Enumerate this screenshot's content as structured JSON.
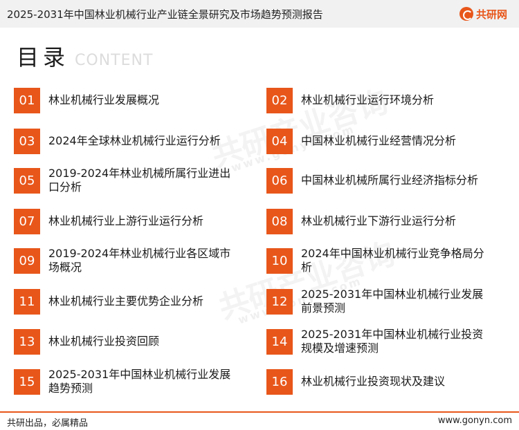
{
  "header": {
    "title": "2025-2031年中国林业机械行业产业链全景研究及市场趋势预测报告",
    "logo_text": "共研网"
  },
  "toc": {
    "title": "目录",
    "subtitle": "CONTENT",
    "items": [
      {
        "num": "01",
        "label": "林业机械行业发展概况"
      },
      {
        "num": "02",
        "label": "林业机械行业运行环境分析"
      },
      {
        "num": "03",
        "label": "2024年全球林业机械行业运行分析"
      },
      {
        "num": "04",
        "label": "中国林业机械行业经营情况分析"
      },
      {
        "num": "05",
        "label": "2019-2024年林业机械所属行业进出口分析"
      },
      {
        "num": "06",
        "label": "中国林业机械所属行业经济指标分析"
      },
      {
        "num": "07",
        "label": "林业机械行业上游行业运行分析"
      },
      {
        "num": "08",
        "label": "林业机械行业下游行业运行分析"
      },
      {
        "num": "09",
        "label": "2019-2024年林业机械行业各区域市场概况"
      },
      {
        "num": "10",
        "label": "2024年中国林业机械行业竞争格局分析"
      },
      {
        "num": "11",
        "label": "林业机械行业主要优势企业分析"
      },
      {
        "num": "12",
        "label": "2025-2031年中国林业机械行业发展前景预测"
      },
      {
        "num": "13",
        "label": "林业机械行业投资回顾"
      },
      {
        "num": "14",
        "label": "2025-2031年中国林业机械行业投资规模及增速预测"
      },
      {
        "num": "15",
        "label": "2025-2031年中国林业机械行业发展趋势预测"
      },
      {
        "num": "16",
        "label": "林业机械行业投资现状及建议"
      }
    ]
  },
  "watermark": {
    "text": "共研产业咨询",
    "url_text": "www.gonyn.com"
  },
  "footer": {
    "left": "共研出品，必属精品",
    "right": "www.gonyn.com"
  },
  "colors": {
    "accent": "#e8561a",
    "header_bg": "#f1f1f1"
  }
}
